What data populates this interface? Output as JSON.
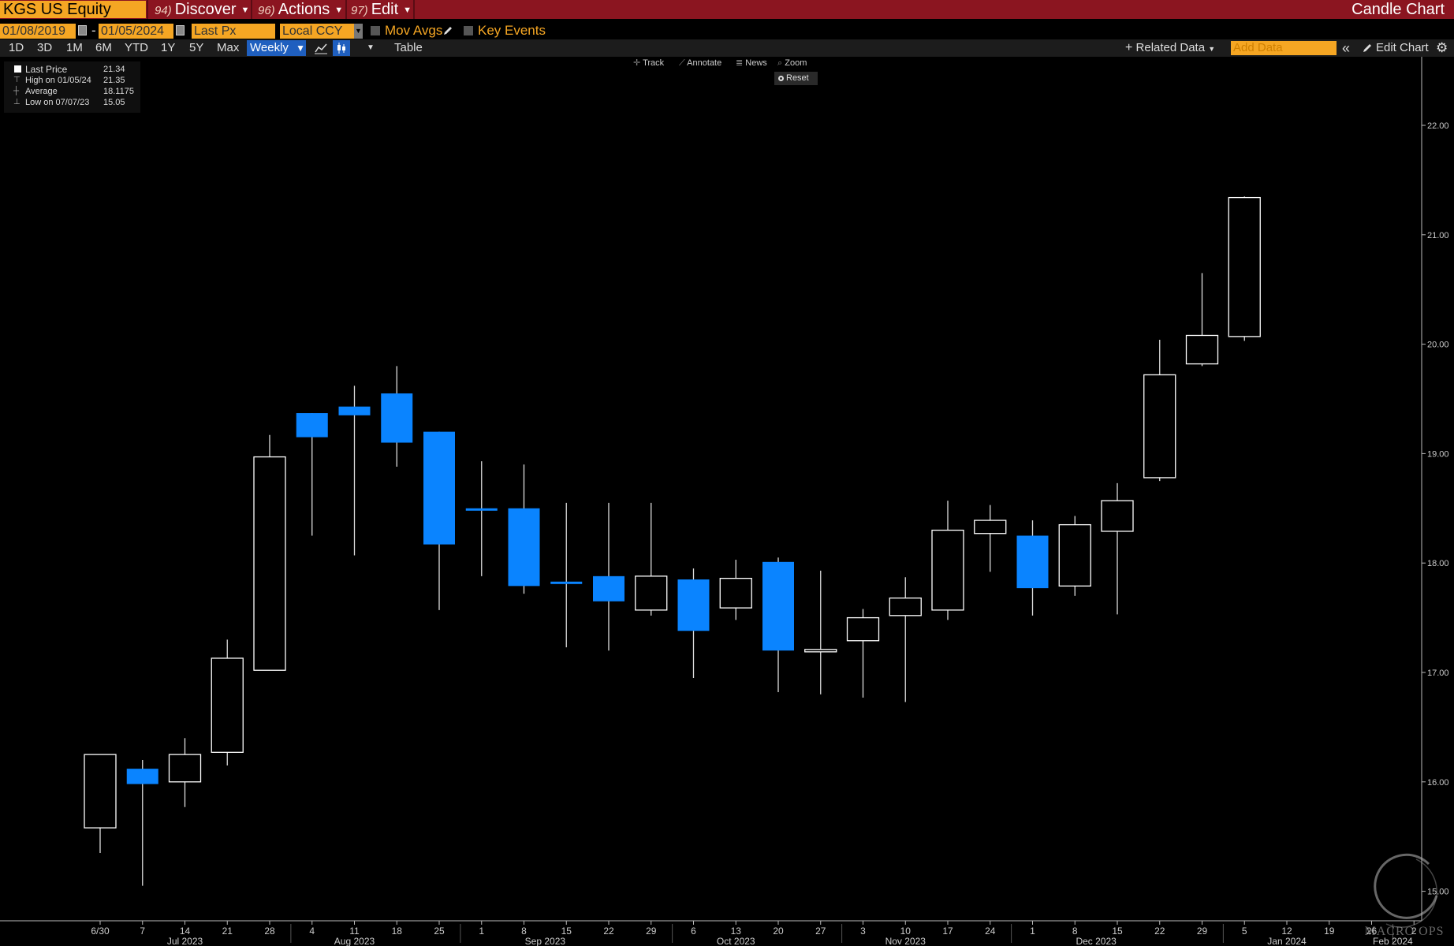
{
  "header": {
    "ticker": "KGS US Equity",
    "menus": [
      {
        "num": "94)",
        "label": "Discover"
      },
      {
        "num": "96)",
        "label": "Actions"
      },
      {
        "num": "97)",
        "label": "Edit"
      }
    ],
    "chart_type_title": "Candle Chart"
  },
  "options": {
    "start_date": "01/08/2019",
    "date_separator": "-",
    "end_date": "01/05/2024",
    "price_field": "Last Px",
    "currency": "Local CCY",
    "mov_avgs": "Mov Avgs",
    "key_events": "Key Events"
  },
  "toolbar": {
    "ranges": [
      "1D",
      "3D",
      "1M",
      "6M",
      "YTD",
      "1Y",
      "5Y",
      "Max"
    ],
    "frequency": "Weekly",
    "table": "Table",
    "related_data": "Related Data",
    "add_data_placeholder": "Add Data",
    "edit_chart": "Edit Chart"
  },
  "tools": {
    "track": "Track",
    "annotate": "Annotate",
    "news": "News",
    "zoom": "Zoom",
    "reset": "Reset"
  },
  "legend": [
    {
      "label": "Last Price",
      "value": "21.34"
    },
    {
      "label": "High on 01/05/24",
      "value": "21.35"
    },
    {
      "label": "Average",
      "value": "18.1175"
    },
    {
      "label": "Low on 07/07/23",
      "value": "15.05"
    }
  ],
  "watermark": "MACRO OPS",
  "colors": {
    "up_candle": "#ffffff",
    "down_candle": "#0a84ff",
    "background": "#000000",
    "header": "#8b1520",
    "accent": "#f5a623"
  },
  "chart_data": {
    "type": "candlestick",
    "title": "",
    "xlabel": "",
    "ylabel": "",
    "ylim": [
      14.75,
      22.5
    ],
    "y_ticks": [
      "15.00",
      "16.00",
      "17.00",
      "18.00",
      "19.00",
      "20.00",
      "21.00",
      "22.00"
    ],
    "x_tick_labels": [
      "6/30",
      "7",
      "14",
      "21",
      "28",
      "4",
      "11",
      "18",
      "25",
      "1",
      "8",
      "15",
      "22",
      "29",
      "6",
      "13",
      "20",
      "27",
      "3",
      "10",
      "17",
      "24",
      "1",
      "8",
      "15",
      "22",
      "29",
      "5",
      "12",
      "19",
      "26",
      "2"
    ],
    "month_labels": [
      {
        "label": "Jul 2023",
        "week_index": 2
      },
      {
        "label": "Aug 2023",
        "week_index": 6
      },
      {
        "label": "Sep 2023",
        "week_index": 10.5
      },
      {
        "label": "Oct 2023",
        "week_index": 15
      },
      {
        "label": "Nov 2023",
        "week_index": 19
      },
      {
        "label": "Dec 2023",
        "week_index": 23.5
      },
      {
        "label": "Jan 2024",
        "week_index": 28
      },
      {
        "label": "Feb 2024",
        "week_index": 30.5
      }
    ],
    "candles": [
      {
        "week": "6/30",
        "open": 15.58,
        "high": 16.25,
        "low": 15.35,
        "close": 16.25
      },
      {
        "week": "7",
        "open": 16.12,
        "high": 16.2,
        "low": 15.05,
        "close": 15.98
      },
      {
        "week": "14",
        "open": 16.0,
        "high": 16.4,
        "low": 15.77,
        "close": 16.25
      },
      {
        "week": "21",
        "open": 16.27,
        "high": 17.3,
        "low": 16.15,
        "close": 17.13
      },
      {
        "week": "28",
        "open": 17.02,
        "high": 19.17,
        "low": 17.02,
        "close": 18.97
      },
      {
        "week": "4",
        "open": 19.37,
        "high": 19.37,
        "low": 18.25,
        "close": 19.15
      },
      {
        "week": "11",
        "open": 19.43,
        "high": 19.62,
        "low": 18.07,
        "close": 19.35
      },
      {
        "week": "18",
        "open": 19.55,
        "high": 19.8,
        "low": 18.88,
        "close": 19.1
      },
      {
        "week": "25",
        "open": 19.2,
        "high": 19.2,
        "low": 17.57,
        "close": 18.17
      },
      {
        "week": "1",
        "open": 18.5,
        "high": 18.93,
        "low": 17.88,
        "close": 18.48
      },
      {
        "week": "8",
        "open": 18.5,
        "high": 18.9,
        "low": 17.72,
        "close": 17.79
      },
      {
        "week": "15",
        "open": 17.83,
        "high": 18.55,
        "low": 17.23,
        "close": 17.81
      },
      {
        "week": "22",
        "open": 17.88,
        "high": 18.55,
        "low": 17.2,
        "close": 17.65
      },
      {
        "week": "29",
        "open": 17.57,
        "high": 18.55,
        "low": 17.52,
        "close": 17.88
      },
      {
        "week": "6",
        "open": 17.85,
        "high": 17.95,
        "low": 16.95,
        "close": 17.38
      },
      {
        "week": "13",
        "open": 17.59,
        "high": 18.03,
        "low": 17.48,
        "close": 17.86
      },
      {
        "week": "20",
        "open": 18.01,
        "high": 18.05,
        "low": 16.82,
        "close": 17.2
      },
      {
        "week": "27",
        "open": 17.19,
        "high": 17.93,
        "low": 16.8,
        "close": 17.21
      },
      {
        "week": "3",
        "open": 17.29,
        "high": 17.58,
        "low": 16.77,
        "close": 17.5
      },
      {
        "week": "10",
        "open": 17.52,
        "high": 17.87,
        "low": 16.73,
        "close": 17.68
      },
      {
        "week": "17",
        "open": 17.57,
        "high": 18.57,
        "low": 17.48,
        "close": 18.3
      },
      {
        "week": "24",
        "open": 18.27,
        "high": 18.53,
        "low": 17.92,
        "close": 18.39
      },
      {
        "week": "1",
        "open": 18.25,
        "high": 18.39,
        "low": 17.52,
        "close": 17.77
      },
      {
        "week": "8",
        "open": 17.79,
        "high": 18.43,
        "low": 17.7,
        "close": 18.35
      },
      {
        "week": "15",
        "open": 18.29,
        "high": 18.73,
        "low": 17.53,
        "close": 18.57
      },
      {
        "week": "22",
        "open": 18.78,
        "high": 20.04,
        "low": 18.75,
        "close": 19.72
      },
      {
        "week": "29",
        "open": 19.82,
        "high": 20.65,
        "low": 19.8,
        "close": 20.08
      },
      {
        "week": "5",
        "open": 20.07,
        "high": 21.35,
        "low": 20.03,
        "close": 21.34
      }
    ]
  }
}
